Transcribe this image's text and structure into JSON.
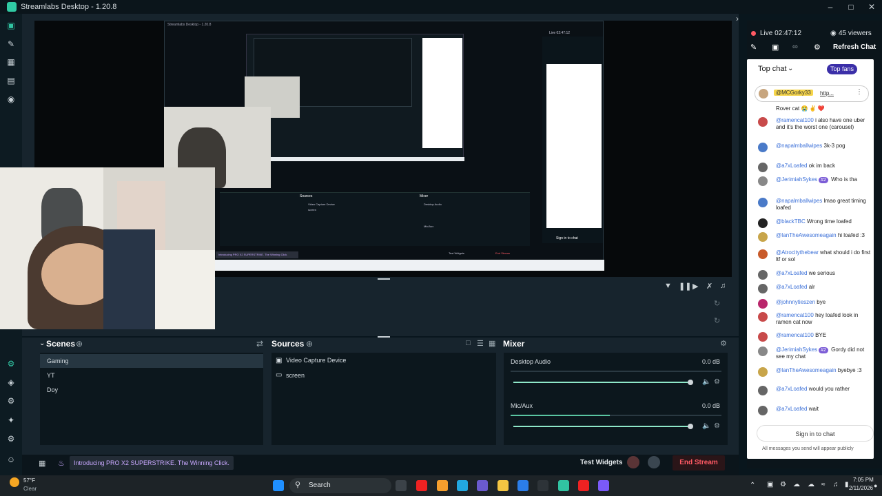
{
  "window": {
    "title": "Streamlabs Desktop - 1.20.8"
  },
  "nav_icons": [
    "camera-icon",
    "pencil-icon",
    "store-icon",
    "layout-icon",
    "compass-icon"
  ],
  "nav_bottom_icons": [
    "plug-icon",
    "palette-icon",
    "gear-icon",
    "settings-icon",
    "bell-icon",
    "user-icon"
  ],
  "nested_preview": {
    "title": "Streamlabs Desktop - 1.20.8",
    "promo": "Introducing PRO X2 SUPERSTRIKE. The Winning Click.",
    "sources": "Sources",
    "mixer": "Mixer",
    "desktop_audio": "Desktop Audio",
    "mic": "Mic/Aux",
    "end": "End Stream",
    "test": "Test Widgets",
    "src1": "Video Capture Device",
    "src2": "screen",
    "chat_signin": "Sign in to chat",
    "live": "Live 02:47:12",
    "viewers": "45 viewers",
    "refresh": "Refresh Chat"
  },
  "scenes": {
    "header": "Scenes",
    "items": [
      "Gaming",
      "YT",
      "Doy"
    ],
    "selected": "Gaming"
  },
  "sources": {
    "header": "Sources",
    "items": [
      {
        "label": "Video Capture Device",
        "icon": "camera-icon"
      },
      {
        "label": "screen",
        "icon": "monitor-icon"
      }
    ]
  },
  "mixer": {
    "header": "Mixer",
    "channels": [
      {
        "label": "Desktop Audio",
        "db": "0.0 dB",
        "level": 0.92
      },
      {
        "label": "Mic/Aux",
        "db": "0.0 dB",
        "level": 0.92
      }
    ]
  },
  "footer": {
    "promo": "Introducing PRO X2 SUPERSTRIKE. The Winning Click.",
    "test_widgets": "Test Widgets",
    "end_stream": "End Stream"
  },
  "live": {
    "time": "Live 02:47:12",
    "viewers": "45 viewers",
    "refresh": "Refresh Chat"
  },
  "chat": {
    "mode": "Top chat",
    "top_fans": "Top fans",
    "pinned_user": "@MCGorky33",
    "pinned_link": "http...",
    "pinned_text": "Rover cat 😭 ✌️ ❤️",
    "messages": [
      {
        "user": "@ramencat100",
        "text": "i also have one uber and it's the worst one (carousel)"
      },
      {
        "user": "@napalmballwipes",
        "text": "3k-3 pog"
      },
      {
        "user": "@a7xLoafed",
        "text": "ok im back"
      },
      {
        "user": "@JerimiahSykes",
        "badge": "#2",
        "text": "Who is tha"
      },
      {
        "user": "@napalmballwipes",
        "text": "lmao great timing loafed"
      },
      {
        "user": "@blackTBC",
        "text": "Wrong time loafed"
      },
      {
        "user": "@IanTheAwesomeagain",
        "text": "hi loafed :3"
      },
      {
        "user": "@Atrocitythebear",
        "text": "what should i do first ltf or sol"
      },
      {
        "user": "@a7xLoafed",
        "text": "we serious"
      },
      {
        "user": "@a7xLoafed",
        "text": "alr"
      },
      {
        "user": "@johnnytieszen",
        "text": "bye"
      },
      {
        "user": "@ramencat100",
        "text": "hey loafed look in ramen cat now"
      },
      {
        "user": "@ramencat100",
        "text": "BYE"
      },
      {
        "user": "@JerimiahSykes",
        "badge": "#2",
        "text": "Gordy did not see my chat"
      },
      {
        "user": "@IanTheAwesomeagain",
        "text": "byebye :3"
      },
      {
        "user": "@a7xLoafed",
        "text": "would you rather"
      },
      {
        "user": "@a7xLoafed",
        "text": "wait"
      }
    ],
    "signin": "Sign in to chat",
    "public_note": "All messages you send will appear publicly"
  },
  "taskbar": {
    "weather_temp": "57°F",
    "weather_desc": "Clear",
    "search": "Search",
    "time": "7:05 PM",
    "date": "2/11/2026"
  },
  "colors": {
    "accent": "#31c3a2",
    "end_stream": "#ff5a64",
    "promo_text": "#c9a8ff"
  }
}
